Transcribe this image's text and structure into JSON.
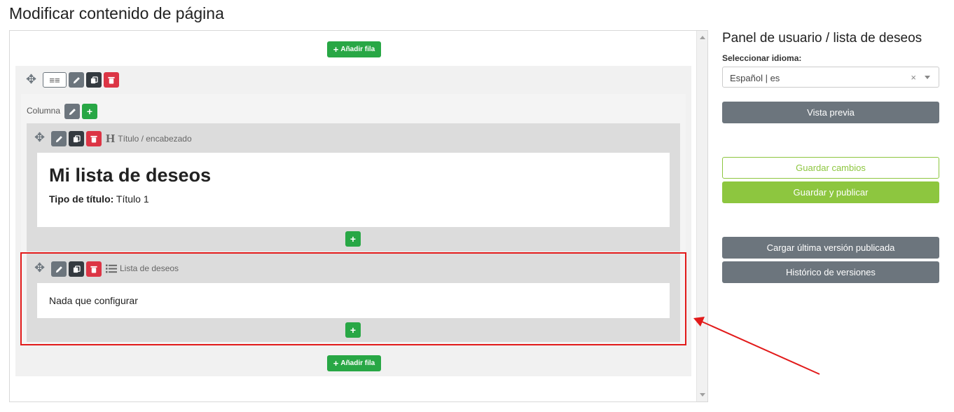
{
  "page": {
    "title": "Modificar contenido de página"
  },
  "editor": {
    "add_row_label": "Añadir fila",
    "column_label": "Columna",
    "blocks": [
      {
        "type_label": "Título / encabezado",
        "content_title": "Mi lista de deseos",
        "content_meta_label": "Tipo de título:",
        "content_meta_value": "Título 1"
      },
      {
        "type_label": "Lista de deseos",
        "content_text": "Nada que configurar"
      }
    ]
  },
  "panel": {
    "title": "Panel de usuario / lista de deseos",
    "language_label": "Seleccionar idioma:",
    "language_value": "Español | es",
    "clear_symbol": "×",
    "preview_button": "Vista previa",
    "save_button": "Guardar cambios",
    "save_publish_button": "Guardar y publicar",
    "load_last_button": "Cargar última versión publicada",
    "history_button": "Histórico de versiones"
  },
  "icons": {
    "move": "move-icon",
    "edit": "pencil-icon",
    "copy": "copy-icon",
    "delete": "trash-icon",
    "heading": "heading-icon",
    "list": "list-icon",
    "plus": "plus-icon"
  },
  "colors": {
    "green": "#28a745",
    "light_green": "#8dc63f",
    "grey": "#6c757d",
    "dark": "#343a40",
    "red": "#dc3545",
    "highlight": "#e21a1a"
  }
}
